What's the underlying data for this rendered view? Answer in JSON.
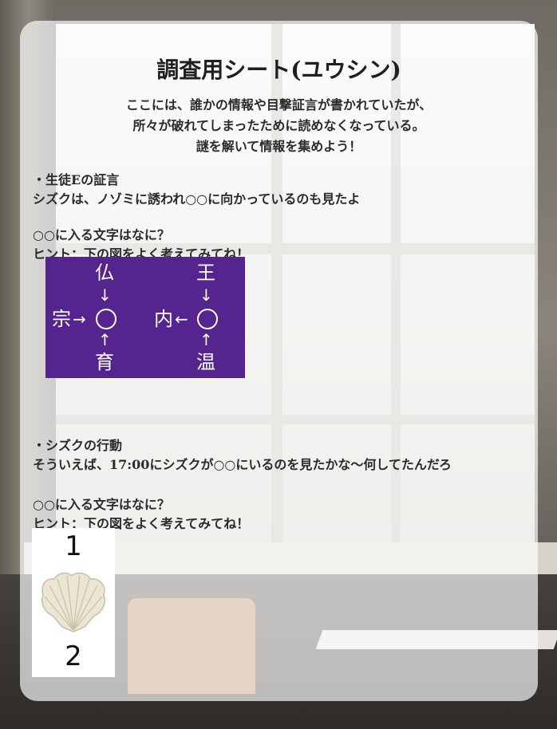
{
  "title": "調査用シート(ユウシン)",
  "intro": [
    "ここには、誰かの情報や目撃証言が書かれていたが、",
    "所々が破れてしまったために読めなくなっている。",
    "謎を解いて情報を集めよう！"
  ],
  "section1": {
    "heading": "・生徒Eの証言",
    "statement": "シズクは、ノゾミに誘われ○○に向かっているのも見たよ",
    "question": "○○に入る文字はなに？",
    "hint": "ヒント：下の図をよく考えてみてね！"
  },
  "puzzle1": {
    "background": "#56248f",
    "left": {
      "top": "仏",
      "left": "宗",
      "bottom": "育",
      "arrow_top": "↓",
      "arrow_left": "→",
      "arrow_bottom": "↑"
    },
    "right": {
      "top": "王",
      "left": "内",
      "bottom": "温",
      "arrow_top": "↓",
      "arrow_left": "←",
      "arrow_bottom": "↑"
    }
  },
  "section2": {
    "heading": "・シズクの行動",
    "statement": "そういえば、17:00にシズクが○○にいるのを見たかな〜何してたんだろ",
    "question": "○○に入る文字はなに？",
    "hint": "ヒント：下の図をよく考えてみてね！"
  },
  "puzzle2": {
    "icon": "scallop-shell-icon",
    "number_top": "1",
    "number_bottom": "2"
  }
}
